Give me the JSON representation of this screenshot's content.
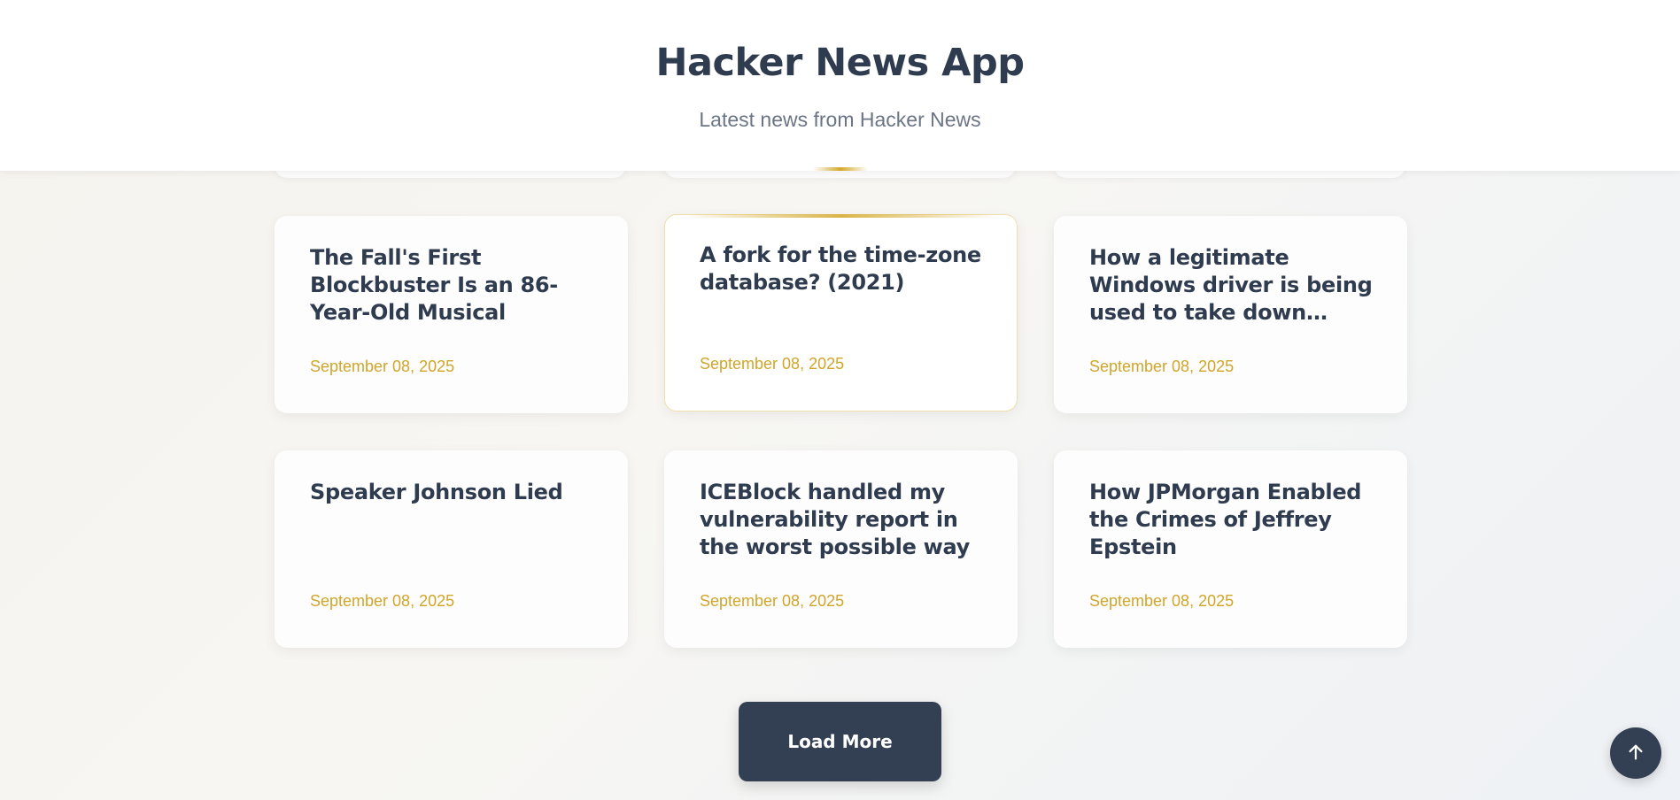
{
  "header": {
    "title": "Hacker News App",
    "subtitle": "Latest news from Hacker News"
  },
  "articles": [
    {
      "title": "The Fall's First Blockbuster Is an 86-Year-Old Musical",
      "date": "September 08, 2025"
    },
    {
      "title": "A fork for the time-zone database? (2021)",
      "date": "September 08, 2025"
    },
    {
      "title": "How a legitimate Windows driver is being used to take down…",
      "date": "September 08, 2025"
    },
    {
      "title": "Speaker Johnson Lied",
      "date": "September 08, 2025"
    },
    {
      "title": "ICEBlock handled my vulnerability report in the worst possible way",
      "date": "September 08, 2025"
    },
    {
      "title": "How JPMorgan Enabled the Crimes of Jeffrey Epstein",
      "date": "September 08, 2025"
    }
  ],
  "load_more_label": "Load More",
  "colors": {
    "accent": "#d0a52a",
    "dark": "#334054",
    "title_text": "#2f3b4e"
  },
  "icons": {
    "scroll_top": "arrow-up-icon"
  }
}
